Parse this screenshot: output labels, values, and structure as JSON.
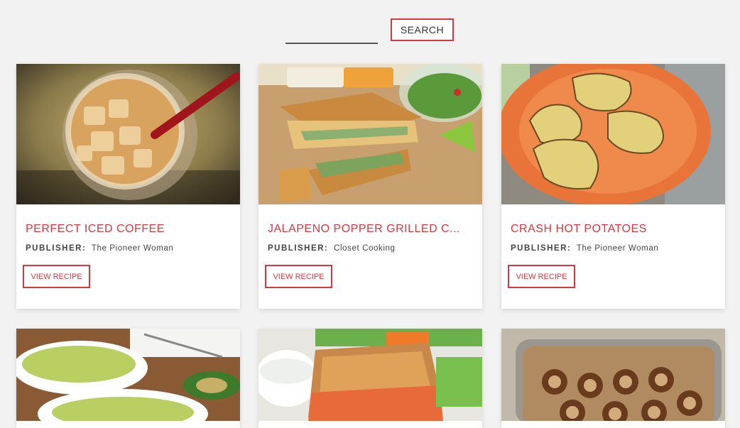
{
  "search": {
    "placeholder": "",
    "value": "",
    "button_label": "SEARCH"
  },
  "recipes": [
    {
      "title": "PERFECT ICED COFFEE",
      "publisher_label": "PUBLISHER:",
      "publisher": "The Pioneer Woman",
      "button_label": "VIEW RECIPE",
      "image_icon": "iced-coffee-image"
    },
    {
      "title": "JALAPENO POPPER GRILLED C...",
      "publisher_label": "PUBLISHER:",
      "publisher": "Closet Cooking",
      "button_label": "VIEW RECIPE",
      "image_icon": "grilled-cheese-image"
    },
    {
      "title": "CRASH HOT POTATOES",
      "publisher_label": "PUBLISHER:",
      "publisher": "The Pioneer Woman",
      "button_label": "VIEW RECIPE",
      "image_icon": "potatoes-image"
    },
    {
      "image_icon": "guacamole-image"
    },
    {
      "image_icon": "grilled-sandwich-image"
    },
    {
      "image_icon": "cinnamon-rolls-image"
    }
  ],
  "colors": {
    "accent": "#d9363e",
    "background": "#f2f2f2"
  }
}
